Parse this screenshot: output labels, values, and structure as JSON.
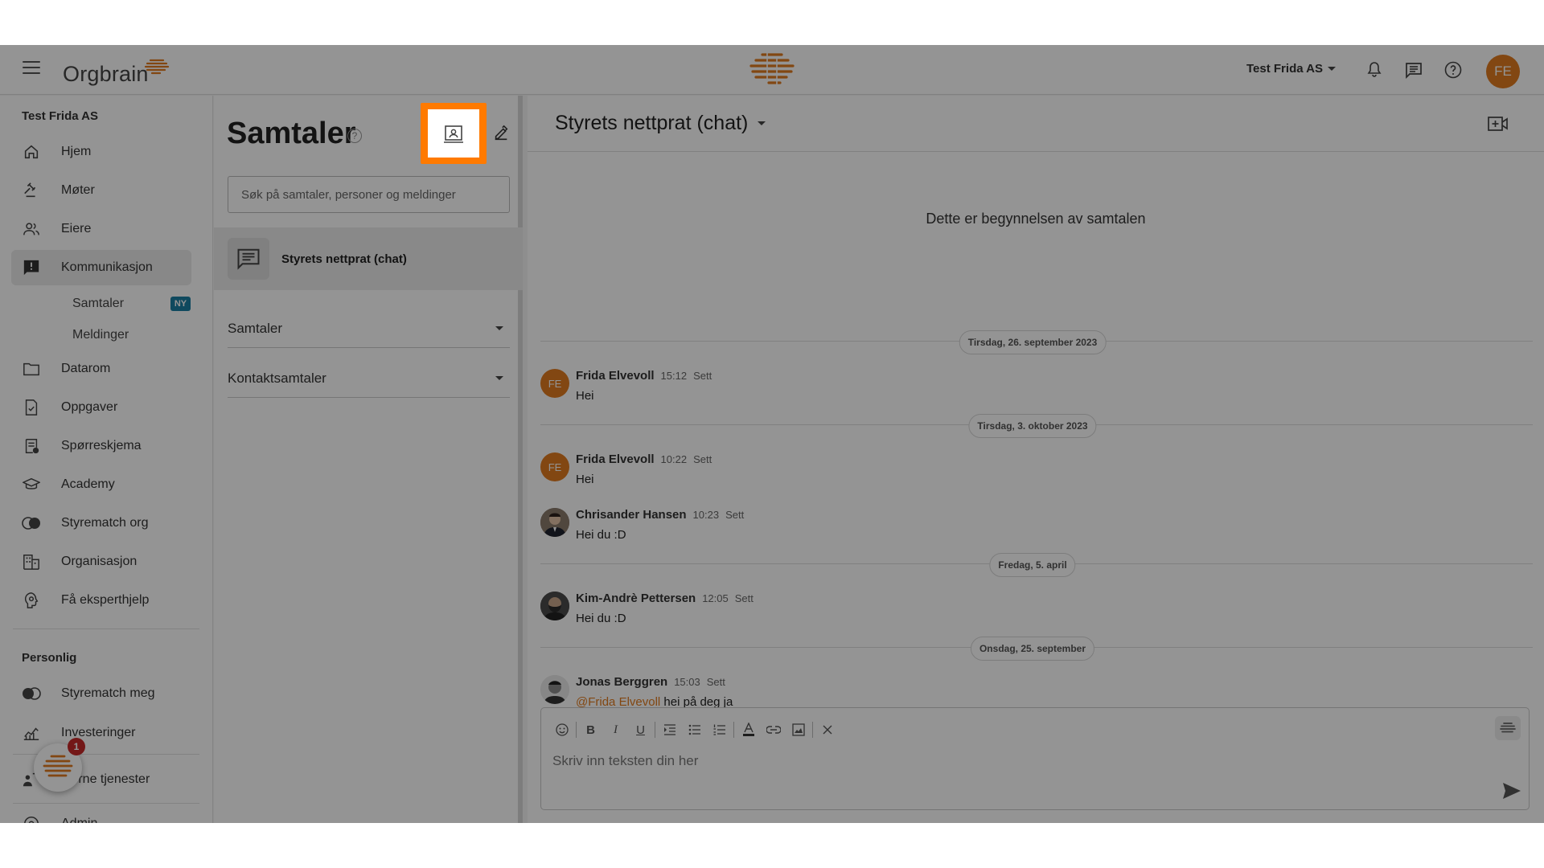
{
  "topbar": {
    "logo_text": "Orgbrain",
    "org_name": "Test Frida AS",
    "user_initials": "FE"
  },
  "sidebar": {
    "org_section": "Test Frida AS",
    "items": [
      {
        "label": "Hjem",
        "icon": "home-icon"
      },
      {
        "label": "Møter",
        "icon": "gavel-icon"
      },
      {
        "label": "Eiere",
        "icon": "people-icon"
      },
      {
        "label": "Kommunikasjon",
        "icon": "chat-alert-icon"
      },
      {
        "label": "Datarom",
        "icon": "folder-icon"
      },
      {
        "label": "Oppgaver",
        "icon": "task-icon"
      },
      {
        "label": "Spørreskjema",
        "icon": "survey-icon"
      },
      {
        "label": "Academy",
        "icon": "graduation-cap-icon"
      },
      {
        "label": "Styrematch org",
        "icon": "toggle-icon"
      },
      {
        "label": "Organisasjon",
        "icon": "building-icon"
      },
      {
        "label": "Få eksperthjelp",
        "icon": "expert-help-icon"
      }
    ],
    "sub_items": [
      {
        "label": "Samtaler",
        "badge": "NY"
      },
      {
        "label": "Meldinger"
      }
    ],
    "personal_section": "Personlig",
    "personal_items": [
      {
        "label": "Styrematch meg",
        "icon": "toggle-icon"
      },
      {
        "label": "Investeringer",
        "icon": "chart-icon"
      },
      {
        "label": "sterne tjenester",
        "icon": "external-services-icon"
      },
      {
        "label": "Admin",
        "icon": "admin-icon"
      }
    ],
    "fab_badge": "1"
  },
  "conversations": {
    "title": "Samtaler",
    "help": "?",
    "search_placeholder": "Søk på samtaler, personer og meldinger",
    "active": "Styrets nettprat (chat)",
    "groups": [
      "Samtaler",
      "Kontaktsamtaler"
    ]
  },
  "chat": {
    "title": "Styrets nettprat (chat)",
    "start_text": "Dette er begynnelsen av samtalen",
    "dates": [
      "Tirsdag, 26. september 2023",
      "Tirsdag, 3. oktober 2023",
      "Fredag, 5. april",
      "Onsdag, 25. september"
    ],
    "messages": [
      {
        "name": "Frida Elvevoll",
        "time": "15:12",
        "seen": "Sett",
        "text": "Hei",
        "initials": "FE"
      },
      {
        "name": "Frida Elvevoll",
        "time": "10:22",
        "seen": "Sett",
        "text": "Hei",
        "initials": "FE"
      },
      {
        "name": "Chrisander Hansen",
        "time": "10:23",
        "seen": "Sett",
        "text": "Hei du :D",
        "initials": ""
      },
      {
        "name": "Kim-Andrè Pettersen",
        "time": "12:05",
        "seen": "Sett",
        "text": "Hei du :D",
        "initials": ""
      },
      {
        "name": "Jonas Berggren",
        "time": "15:03",
        "seen": "Sett",
        "mention": "@Frida Elvevoll",
        "text": " hei på deg ja",
        "initials": ""
      }
    ],
    "editor_placeholder": "Skriv inn teksten din her"
  },
  "colors": {
    "accent": "#e07a1f",
    "highlight": "#ff7a00",
    "badge": "#1b7fa3",
    "notification": "#c62828"
  }
}
